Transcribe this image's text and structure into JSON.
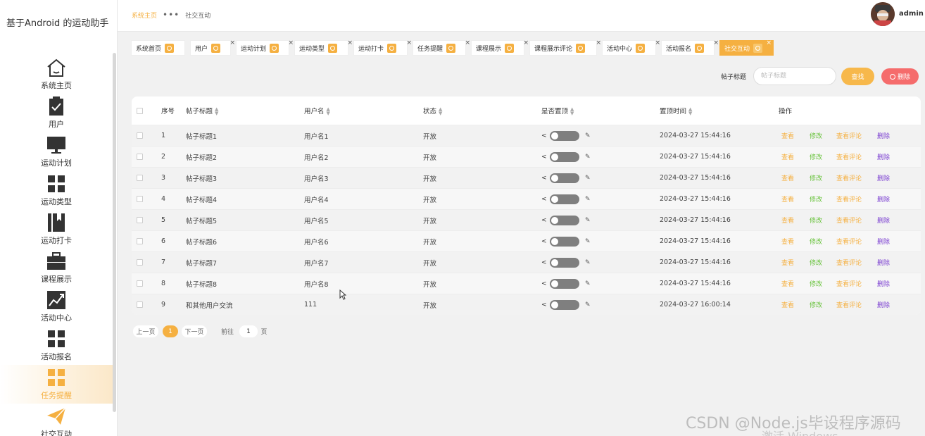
{
  "app": {
    "title": "基于Android 的运动助手"
  },
  "colors": {
    "accent": "#f5b041",
    "delete": "#f56c6c",
    "edit": "#67c23a",
    "del_link": "#7b3fd1"
  },
  "sidebar": {
    "items": [
      {
        "label": "系统主页",
        "icon": "home-icon"
      },
      {
        "label": "用户",
        "icon": "clipboard-icon"
      },
      {
        "label": "运动计划",
        "icon": "monitor-icon"
      },
      {
        "label": "运动类型",
        "icon": "grid-icon"
      },
      {
        "label": "运动打卡",
        "icon": "book-icon"
      },
      {
        "label": "课程展示",
        "icon": "briefcase-icon"
      },
      {
        "label": "活动中心",
        "icon": "chart-icon"
      },
      {
        "label": "活动报名",
        "icon": "grid-icon"
      },
      {
        "label": "任务提醒",
        "icon": "grid-icon",
        "active": true
      },
      {
        "label": "社交互动",
        "icon": "paper-plane-icon"
      }
    ]
  },
  "header": {
    "breadcrumb_home": "系统主页",
    "breadcrumb_sep": "•••",
    "breadcrumb_current": "社交互动",
    "username": "admin"
  },
  "tabs": [
    {
      "label": "系统首页"
    },
    {
      "label": "用户"
    },
    {
      "label": "运动计划"
    },
    {
      "label": "运动类型"
    },
    {
      "label": "运动打卡"
    },
    {
      "label": "任务提醒"
    },
    {
      "label": "课程展示"
    },
    {
      "label": "课程展示评论"
    },
    {
      "label": "活动中心"
    },
    {
      "label": "活动报名"
    },
    {
      "label": "社交互动",
      "active": true
    }
  ],
  "search": {
    "label": "帖子标题",
    "placeholder": "帖子标题",
    "search_button": "查找",
    "delete_button": "删除"
  },
  "table": {
    "columns": [
      "序号",
      "帖子标题",
      "用户名",
      "状态",
      "是否置顶",
      "置顶时间",
      "操作"
    ],
    "rows": [
      {
        "no": "1",
        "title": "帖子标题1",
        "user": "用户名1",
        "status": "开放",
        "pinned": false,
        "time": "2024-03-27 15:44:16"
      },
      {
        "no": "2",
        "title": "帖子标题2",
        "user": "用户名2",
        "status": "开放",
        "pinned": false,
        "time": "2024-03-27 15:44:16"
      },
      {
        "no": "3",
        "title": "帖子标题3",
        "user": "用户名3",
        "status": "开放",
        "pinned": false,
        "time": "2024-03-27 15:44:16"
      },
      {
        "no": "4",
        "title": "帖子标题4",
        "user": "用户名4",
        "status": "开放",
        "pinned": false,
        "time": "2024-03-27 15:44:16"
      },
      {
        "no": "5",
        "title": "帖子标题5",
        "user": "用户名5",
        "status": "开放",
        "pinned": false,
        "time": "2024-03-27 15:44:16"
      },
      {
        "no": "6",
        "title": "帖子标题6",
        "user": "用户名6",
        "status": "开放",
        "pinned": false,
        "time": "2024-03-27 15:44:16"
      },
      {
        "no": "7",
        "title": "帖子标题7",
        "user": "用户名7",
        "status": "开放",
        "pinned": false,
        "time": "2024-03-27 15:44:16"
      },
      {
        "no": "8",
        "title": "帖子标题8",
        "user": "用户名8",
        "status": "开放",
        "pinned": false,
        "time": "2024-03-27 15:44:16"
      },
      {
        "no": "9",
        "title": "和其他用户交流",
        "user": "111",
        "status": "开放",
        "pinned": false,
        "time": "2024-03-27 16:00:14"
      }
    ],
    "actions": {
      "view": "查看",
      "edit": "修改",
      "comments": "查看评论",
      "delete": "删除"
    }
  },
  "pagination": {
    "prev": "上一页",
    "current": "1",
    "next": "下一页",
    "goto_prefix": "前往",
    "goto_value": "1",
    "goto_suffix": "页"
  },
  "watermark": {
    "line1": "CSDN @Node.js毕设程序源码",
    "line2": "激活 Windows"
  }
}
